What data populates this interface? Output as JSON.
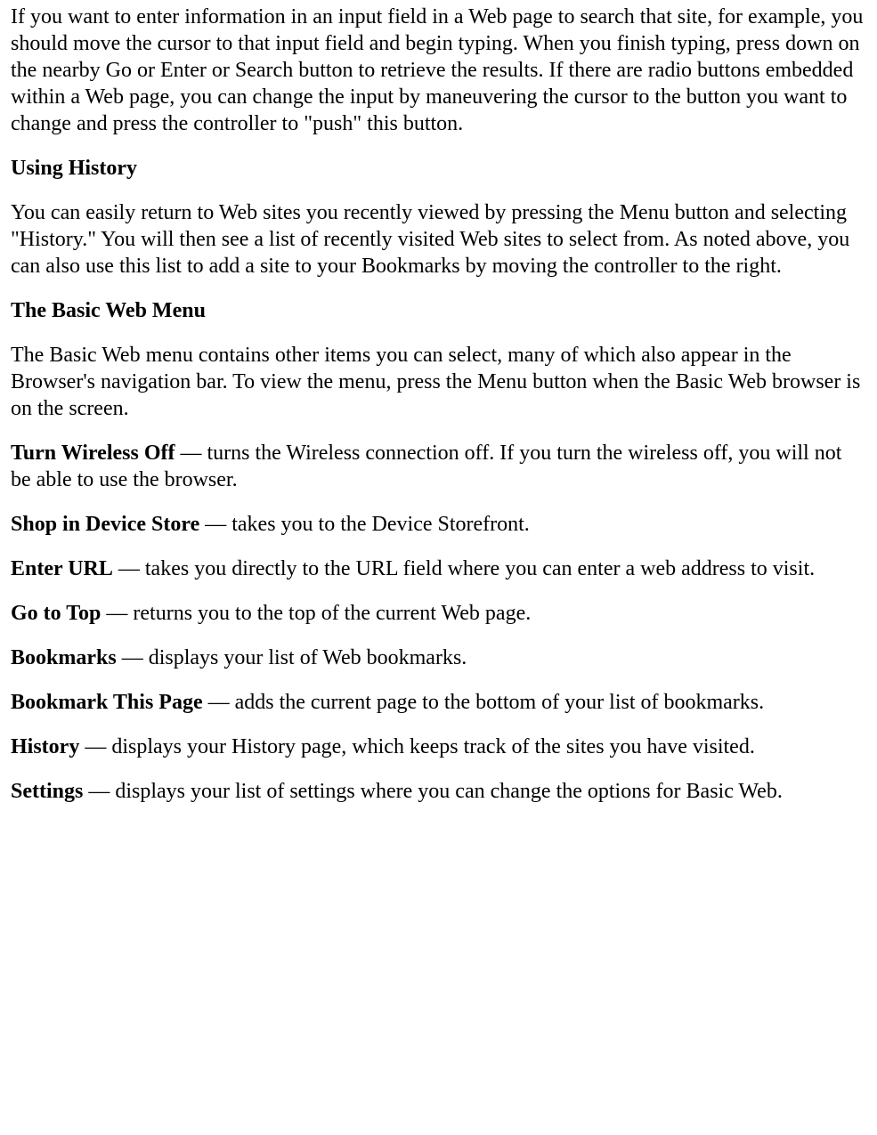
{
  "intro_paragraph": "If you want to enter information in an input field in a Web page to search that site, for example, you should move the cursor to that input field and begin typing. When you finish typing, press down on the nearby Go or Enter or Search button to retrieve the results. If there are radio buttons embedded within a Web page, you can change the input by maneuvering the cursor to the button you want to change and press the controller to \"push\" this button.",
  "sections": {
    "using_history": {
      "heading": "Using History",
      "body": "You can easily return to Web sites you recently viewed by pressing the Menu button and selecting \"History.\" You will then see a list of recently visited Web sites to select from. As noted above, you can also use this list to add a site to your Bookmarks by moving the controller to the right."
    },
    "basic_web_menu": {
      "heading": "The Basic Web Menu",
      "body": "The Basic Web menu contains other items you can select, many of which also appear in the Browser's navigation bar. To view the menu, press the Menu button when the Basic Web browser is on the screen."
    }
  },
  "separator": " — ",
  "menu_items": [
    {
      "term": "Turn Wireless Off",
      "desc": "turns the Wireless connection off. If you turn the wireless off, you will not be able to use the browser."
    },
    {
      "term": "Shop in Device Store",
      "desc": "takes you to the Device Storefront."
    },
    {
      "term": "Enter URL",
      "desc": "takes you directly to the URL field where you can enter a web address to visit."
    },
    {
      "term": "Go to Top",
      "desc": "returns you to the top of the current Web page."
    },
    {
      "term": "Bookmarks",
      "desc": "displays your list of Web bookmarks."
    },
    {
      "term": "Bookmark This Page",
      "desc": "adds the current page to the bottom of your list of bookmarks."
    },
    {
      "term": "History",
      "desc": "displays your History page, which keeps track of the sites you have visited."
    },
    {
      "term": "Settings",
      "desc": "displays your list of settings where you can change the options for Basic Web."
    }
  ]
}
